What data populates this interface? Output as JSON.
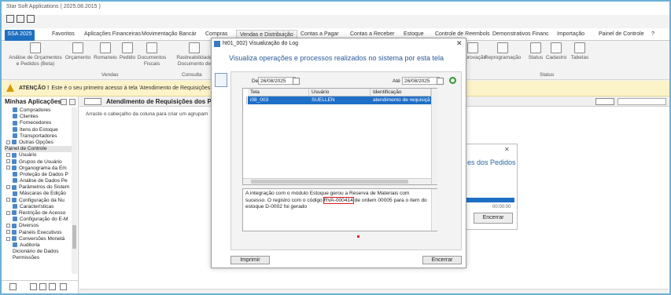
{
  "app": {
    "title": "Star Soft Applications ( 2025.08.2015 )"
  },
  "tabs": [
    "SSA 2025",
    "Favoritos",
    "Aplicações Financeiras",
    "Movimentação Bancár",
    "Compras",
    "Vendas e Distribuição",
    "Contas a Pagar",
    "Contas a Receber",
    "Estoque",
    "Controle de Reembols",
    "Demonstrativos Financ",
    "Importação",
    "Painel de Controle"
  ],
  "tab_extra": "?",
  "ribbon": {
    "items": [
      "Análise de Orçamentos e Pedidos (Beta)",
      "Orçamento",
      "Romaneio",
      "Pedido",
      "Documentos Fiscais",
      "Rastreabilidade Documento de",
      "Aprovação",
      "Reprogramação",
      "Status",
      "Cadastro",
      "Tabelas"
    ],
    "groups": [
      "Vendas",
      "Consulta",
      "Status"
    ]
  },
  "alert": {
    "label": "ATENÇÃO !",
    "text": "Este é o seu primeiro acesso à tela 'Atendimento de Requisições dos P"
  },
  "sidebar": {
    "title": "Minhas Aplicações",
    "items": [
      "Compradores",
      "Clientes",
      "Fornecedores",
      "Itens do Estoque",
      "Transportadores",
      "Outras Opções",
      "Painel de Controle",
      "Usuário",
      "Grupos de Usuário",
      "Organograma da Em",
      "Proteção de Dados P",
      "Análise de Dados Pe",
      "Parâmetros do Sistem",
      "Máscaras de Edição",
      "Configuração da Nu",
      "Características",
      "Restrição de Acesso",
      "Configuração do E-M",
      "Diversos",
      "Painéis Executivos",
      "Conversões Monetá",
      "Auditoria",
      "Dicionário de Dados",
      "Permissões"
    ]
  },
  "main": {
    "title": "Atendimento de Requisições dos Pedido",
    "group_hint": "Arraste o cabeçalho da coluna para criar um agrupam"
  },
  "bg_dialog": {
    "heading": "es dos Pedidos",
    "time": "00:00:00",
    "cancel": "Encerrar"
  },
  "dialog": {
    "caption": "ht01_002) Visualização do Log",
    "heading": "Visualiza operações e processos realizados no sistema por esta tela",
    "de_label": "De",
    "date_from": "26/08/2025",
    "ate_label": "Até",
    "date_to": "26/08/2025",
    "columns": [
      "Tela",
      "Usuário",
      "Identificação"
    ],
    "row": [
      "i08_003",
      "SUELLEN",
      "atendimento de requisiçã"
    ],
    "message_before": "A integração com o módulo Estoque gerou a Reserva de Materiais com sucesso. O registro com o código ",
    "message_code": "RVA-000414",
    "message_after": " de ordem 00005 para o item do estoque D-0002 foi gerado",
    "print_label": "Imprimir",
    "close_label": "Encerrar"
  }
}
